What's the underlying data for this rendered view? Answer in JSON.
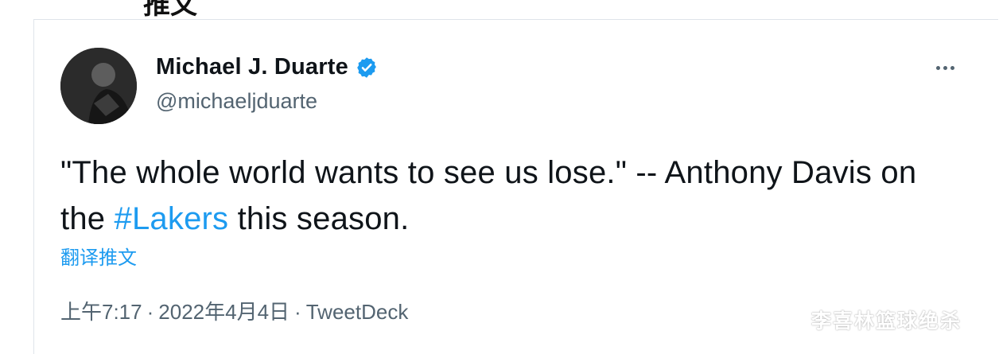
{
  "header_cut": {
    "text": "推文"
  },
  "tweet": {
    "display_name": "Michael J. Duarte",
    "handle": "@michaeljduarte",
    "text_before": "\"The whole world wants to see us lose.\" -- Anthony Davis on the ",
    "hashtag": "#Lakers",
    "text_after": " this season.",
    "translate_label": "翻译推文",
    "time": "上午7:17",
    "date": "2022年4月4日",
    "separator": "·",
    "source": "TweetDeck"
  },
  "icons": {
    "verified": "verified-badge-icon",
    "more": "more-options-icon"
  },
  "colors": {
    "accent": "#1d9bf0",
    "muted": "#536471",
    "text": "#0f1419"
  },
  "watermark": {
    "text": "李喜林篮球绝杀"
  }
}
